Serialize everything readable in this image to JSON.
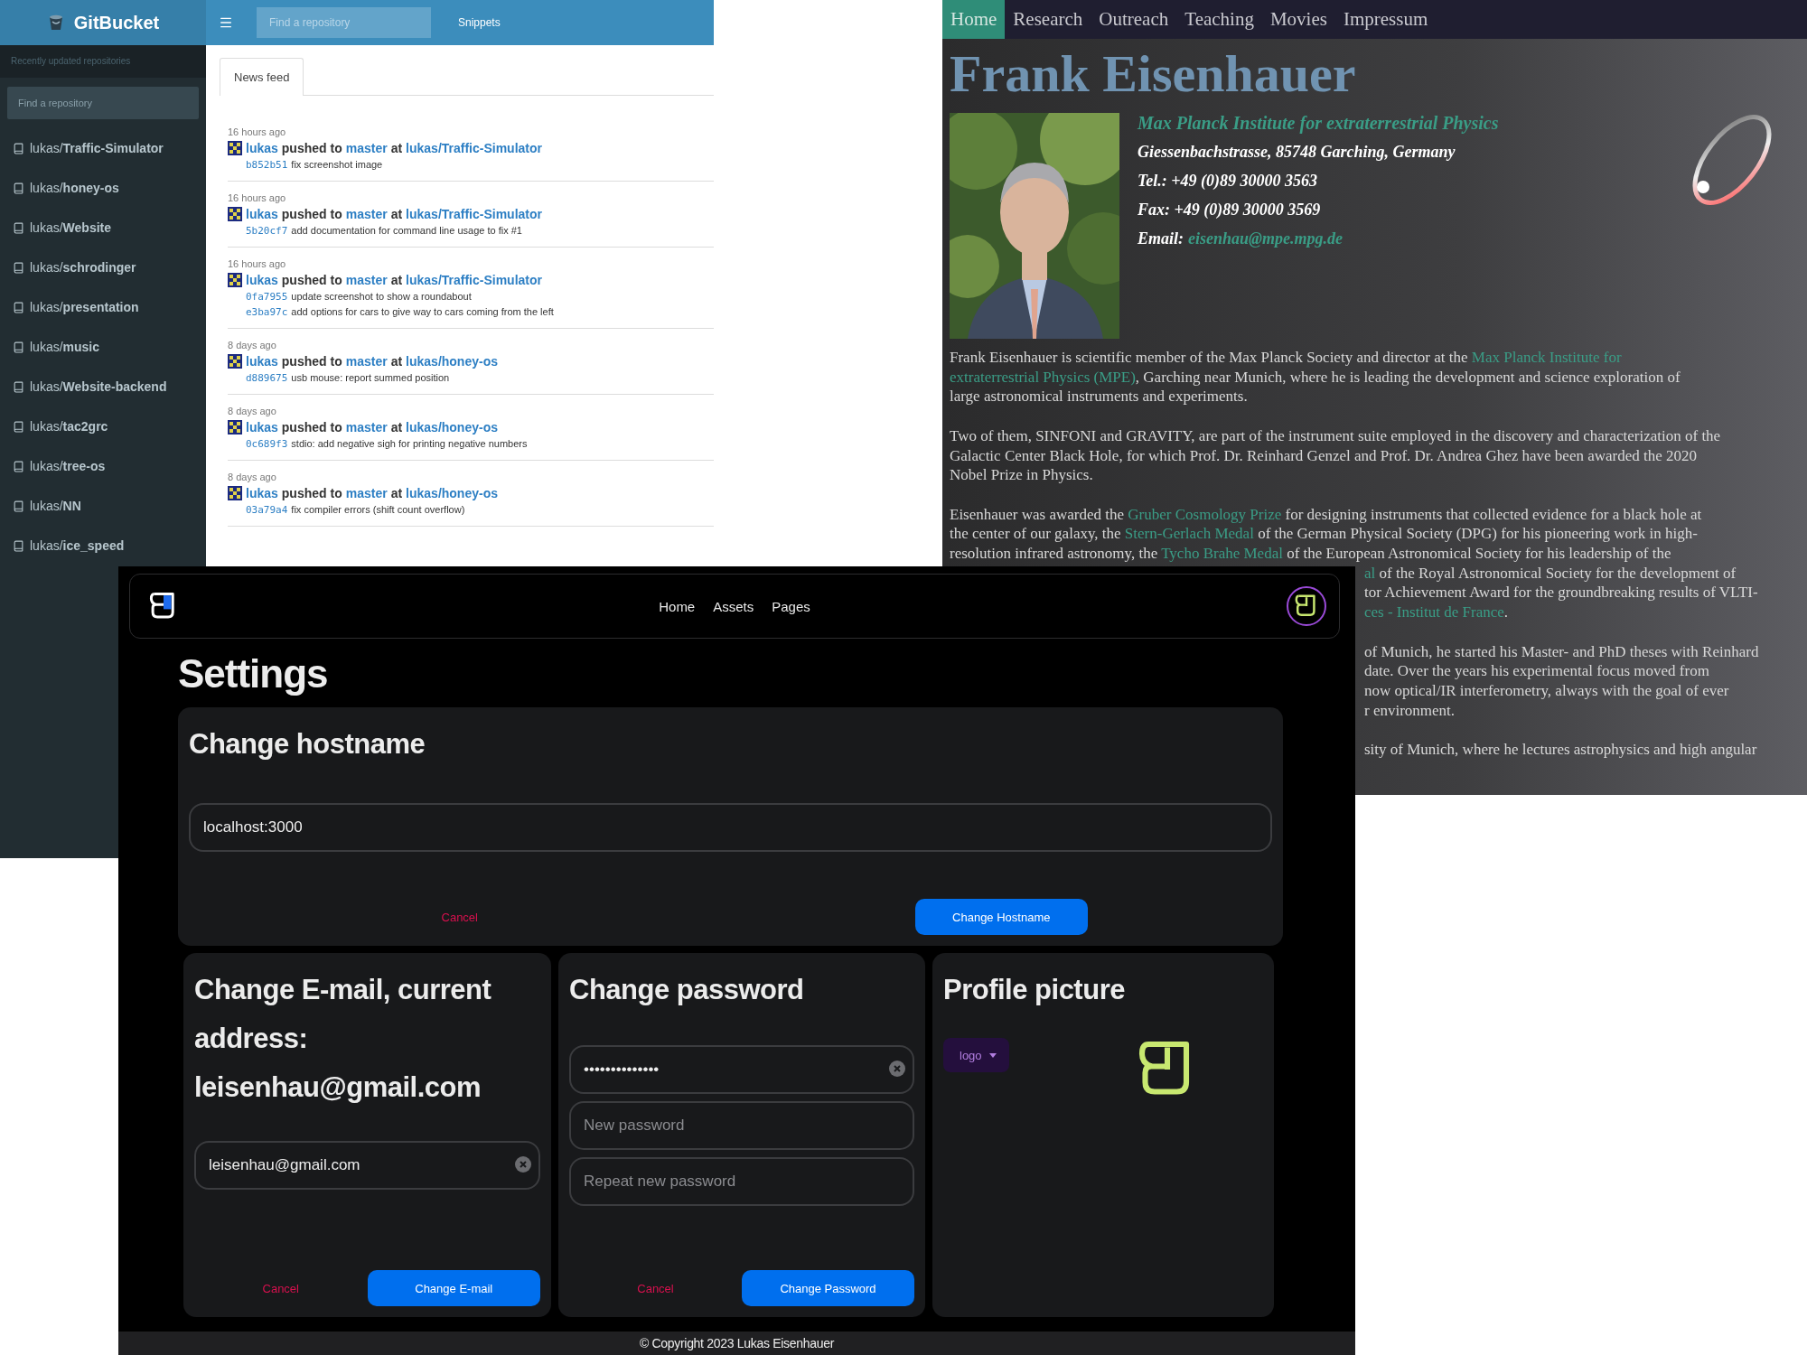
{
  "gitbucket": {
    "brand": "GitBucket",
    "search": {
      "placeholder": "Find a repository"
    },
    "nav": [
      "Snippets"
    ],
    "sidebar": {
      "heading": "Recently updated repositories",
      "search": {
        "placeholder": "Find a repository"
      },
      "repos": [
        {
          "owner": "lukas/",
          "name": "Traffic-Simulator"
        },
        {
          "owner": "lukas/",
          "name": "honey-os"
        },
        {
          "owner": "lukas/",
          "name": "Website"
        },
        {
          "owner": "lukas/",
          "name": "schrodinger"
        },
        {
          "owner": "lukas/",
          "name": "presentation"
        },
        {
          "owner": "lukas/",
          "name": "music"
        },
        {
          "owner": "lukas/",
          "name": "Website-backend"
        },
        {
          "owner": "lukas/",
          "name": "tac2grc"
        },
        {
          "owner": "lukas/",
          "name": "tree-os"
        },
        {
          "owner": "lukas/",
          "name": "NN"
        },
        {
          "owner": "lukas/",
          "name": "ice_speed"
        }
      ]
    },
    "tabs": [
      {
        "label": "News feed",
        "selected": true
      }
    ],
    "feed": [
      {
        "time": "16 hours ago",
        "user": "lukas",
        "action": "pushed to",
        "branch": "master",
        "at": "at",
        "repo": "lukas/Traffic-Simulator",
        "commits": [
          {
            "hash": "b852b51",
            "message": "fix screenshot image"
          }
        ]
      },
      {
        "time": "16 hours ago",
        "user": "lukas",
        "action": "pushed to",
        "branch": "master",
        "at": "at",
        "repo": "lukas/Traffic-Simulator",
        "commits": [
          {
            "hash": "5b20cf7",
            "message": "add documentation for command line usage to fix #1"
          }
        ]
      },
      {
        "time": "16 hours ago",
        "user": "lukas",
        "action": "pushed to",
        "branch": "master",
        "at": "at",
        "repo": "lukas/Traffic-Simulator",
        "commits": [
          {
            "hash": "0fa7955",
            "message": "update screenshot to show a roundabout"
          },
          {
            "hash": "e3ba97c",
            "message": "add options for cars to give way to cars coming from the left"
          }
        ]
      },
      {
        "time": "8 days ago",
        "user": "lukas",
        "action": "pushed to",
        "branch": "master",
        "at": "at",
        "repo": "lukas/honey-os",
        "commits": [
          {
            "hash": "d889675",
            "message": "usb mouse: report summed position"
          }
        ]
      },
      {
        "time": "8 days ago",
        "user": "lukas",
        "action": "pushed to",
        "branch": "master",
        "at": "at",
        "repo": "lukas/honey-os",
        "commits": [
          {
            "hash": "0c689f3",
            "message": "stdio: add negative sigh for printing negative numbers"
          }
        ]
      },
      {
        "time": "8 days ago",
        "user": "lukas",
        "action": "pushed to",
        "branch": "master",
        "at": "at",
        "repo": "lukas/honey-os",
        "commits": [
          {
            "hash": "03a79a4",
            "message": "fix compiler errors (shift count overflow)"
          }
        ]
      }
    ]
  },
  "website": {
    "nav": [
      {
        "label": "Home",
        "selected": true
      },
      {
        "label": "Research",
        "selected": false
      },
      {
        "label": "Outreach",
        "selected": false
      },
      {
        "label": "Teaching",
        "selected": false
      },
      {
        "label": "Movies",
        "selected": false
      },
      {
        "label": "Impressum",
        "selected": false
      }
    ],
    "title": "Frank Eisenhauer",
    "contact": [
      {
        "kind": "institute",
        "text": "Max Planck Institute for extraterrestrial Physics"
      },
      {
        "kind": "plain",
        "text": "Giessenbachstrasse, 85748 Garching, Germany"
      },
      {
        "kind": "plain",
        "text": "Tel.: +49 (0)89 30000 3563"
      },
      {
        "kind": "plain",
        "text": "Fax: +49 (0)89 30000 3569"
      },
      {
        "kind": "email",
        "label": "Email:",
        "link": "eisenhau@mpe.mpg.de"
      }
    ],
    "paragraphs": [
      {
        "lines": [
          {
            "kind": "full",
            "parts": [
              {
                "kind": "text",
                "text": "Frank Eisenhauer is scientific member of the Max Planck Society and director at the "
              },
              {
                "kind": "link",
                "text": "Max Planck Institute for"
              }
            ]
          },
          {
            "kind": "full",
            "parts": [
              {
                "kind": "link",
                "text": "extraterrestrial Physics (MPE)"
              },
              {
                "kind": "text",
                "text": ", Garching near Munich, where he is leading the development and science exploration of"
              }
            ]
          },
          {
            "kind": "full",
            "parts": [
              {
                "kind": "text",
                "text": "large astronomical instruments and experiments."
              }
            ]
          }
        ]
      },
      {
        "lines": [
          {
            "kind": "full",
            "parts": [
              {
                "kind": "text",
                "text": "Two of them, SINFONI and GRAVITY, are part of the instrument suite employed in the discovery and characterization of the"
              }
            ]
          },
          {
            "kind": "full",
            "parts": [
              {
                "kind": "text",
                "text": "Galactic Center Black Hole, for which Prof. Dr. Reinhard Genzel and Prof. Dr. Andrea Ghez have been awarded the 2020"
              }
            ]
          },
          {
            "kind": "full",
            "parts": [
              {
                "kind": "text",
                "text": "Nobel Prize in Physics."
              }
            ]
          }
        ]
      },
      {
        "lines": [
          {
            "kind": "full",
            "parts": [
              {
                "kind": "text",
                "text": "Eisenhauer was awarded the "
              },
              {
                "kind": "link",
                "text": "Gruber Cosmology Prize"
              },
              {
                "kind": "text",
                "text": " for designing instruments that collected evidence for a black hole at"
              }
            ]
          },
          {
            "kind": "full",
            "parts": [
              {
                "kind": "text",
                "text": "the center of our galaxy, the "
              },
              {
                "kind": "link",
                "text": "Stern-Gerlach Medal"
              },
              {
                "kind": "text",
                "text": " of the German Physical Society (DPG) for his pioneering work in high-"
              }
            ]
          },
          {
            "kind": "full",
            "parts": [
              {
                "kind": "text",
                "text": "resolution infrared astronomy, the "
              },
              {
                "kind": "link",
                "text": "Tycho Brahe Medal"
              },
              {
                "kind": "text",
                "text": " of the European Astronomical Society for his leadership of the"
              }
            ]
          },
          {
            "kind": "fragment",
            "parts": [
              {
                "kind": "link",
                "text": "al"
              },
              {
                "kind": "text",
                "text": " of the Royal Astronomical Society for the development of"
              }
            ]
          },
          {
            "kind": "fragment",
            "parts": [
              {
                "kind": "text",
                "text": "tor Achievement Award for the groundbreaking results of VLTI-"
              }
            ]
          },
          {
            "kind": "fragment",
            "parts": [
              {
                "kind": "link",
                "text": "ces - Institut de France"
              },
              {
                "kind": "text",
                "text": "."
              }
            ]
          }
        ]
      },
      {
        "lines": [
          {
            "kind": "fragment",
            "parts": [
              {
                "kind": "text",
                "text": "of Munich, he started his Master- and PhD theses with Reinhard"
              }
            ]
          },
          {
            "kind": "fragment",
            "parts": [
              {
                "kind": "text",
                "text": "date. Over the years his experimental focus moved from"
              }
            ]
          },
          {
            "kind": "fragment",
            "parts": [
              {
                "kind": "text",
                "text": "now optical/IR interferometry, always with the goal of ever"
              }
            ]
          },
          {
            "kind": "fragment",
            "parts": [
              {
                "kind": "text",
                "text": "r environment."
              }
            ]
          }
        ]
      },
      {
        "lines": [
          {
            "kind": "fragment",
            "parts": [
              {
                "kind": "text",
                "text": "sity of Munich, where he lectures astrophysics and high angular"
              }
            ]
          }
        ]
      }
    ]
  },
  "settings": {
    "nav": [
      "Home",
      "Assets",
      "Pages"
    ],
    "title": "Settings",
    "hostname": {
      "title": "Change hostname",
      "value": "localhost:3000",
      "cancel": "Cancel",
      "submit": "Change Hostname"
    },
    "email": {
      "title": "Change E-mail, current address: leisenhau@gmail.com",
      "value": "leisenhau@gmail.com",
      "cancel": "Cancel",
      "submit": "Change E-mail"
    },
    "password": {
      "title": "Change password",
      "fields": [
        {
          "value": "••••••••••••••"
        },
        {
          "placeholder": "New password"
        },
        {
          "placeholder": "Repeat new password"
        }
      ],
      "cancel": "Cancel",
      "submit": "Change Password"
    },
    "profile": {
      "title": "Profile picture",
      "select": "logo"
    },
    "footer": "© Copyright 2023 Lukas Eisenhauer"
  }
}
